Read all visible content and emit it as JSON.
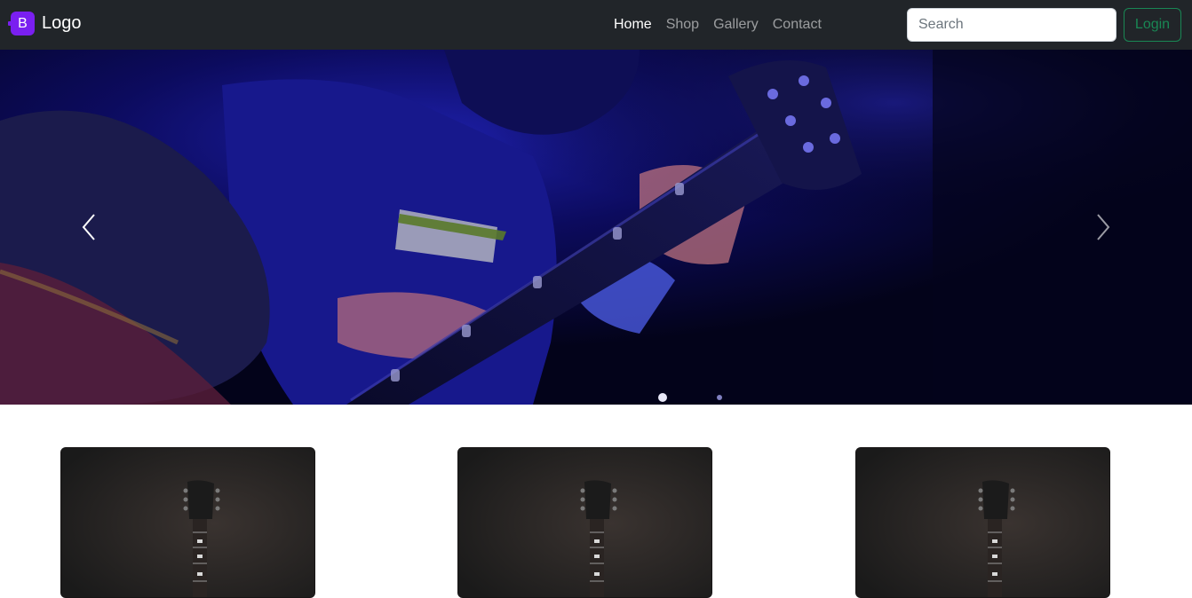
{
  "navbar": {
    "brand_icon_letter": "B",
    "brand_text": "Logo",
    "links": [
      {
        "label": "Home",
        "active": true
      },
      {
        "label": "Shop",
        "active": false
      },
      {
        "label": "Gallery",
        "active": false
      },
      {
        "label": "Contact",
        "active": false
      }
    ],
    "search_placeholder": "Search",
    "login_label": "Login"
  },
  "carousel": {
    "prev_icon": "chevron-left-icon",
    "next_icon": "chevron-right-icon"
  },
  "cards": [
    {
      "image": "guitar-headstock-image"
    },
    {
      "image": "guitar-headstock-image"
    },
    {
      "image": "guitar-headstock-image"
    }
  ],
  "colors": {
    "navbar_bg": "#212529",
    "brand_purple": "#7a1ff0",
    "login_green": "#198754"
  }
}
